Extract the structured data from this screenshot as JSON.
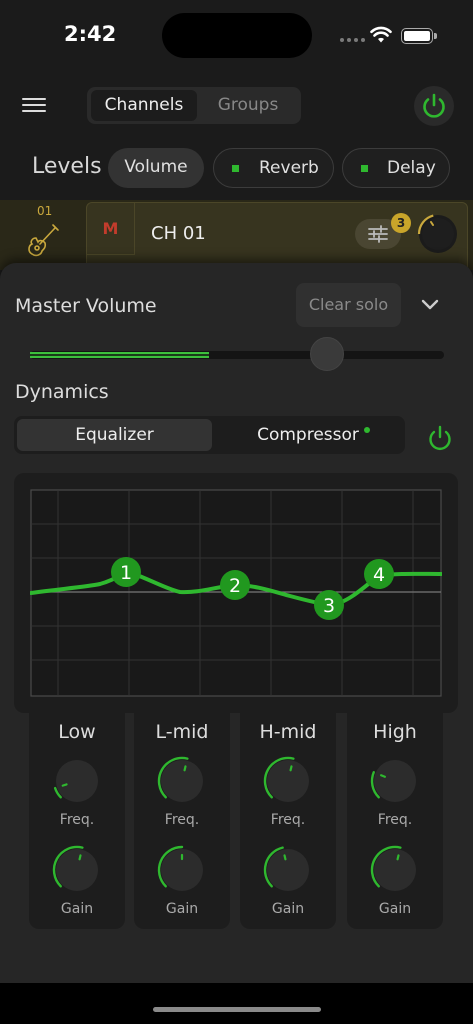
{
  "status_bar": {
    "time": "2:42"
  },
  "nav": {
    "tabs": [
      {
        "label": "Channels"
      },
      {
        "label": "Groups"
      }
    ]
  },
  "levels": {
    "label": "Levels",
    "pills": [
      {
        "label": "Volume"
      },
      {
        "label": "Reverb"
      },
      {
        "label": "Delay"
      }
    ]
  },
  "channel": {
    "number": "01",
    "mute_label": "M",
    "name": "CH 01",
    "fx_badge": "3"
  },
  "master": {
    "label": "Master Volume",
    "clear_solo_label": "Clear solo",
    "volume_level": 0.5
  },
  "dynamics": {
    "label": "Dynamics",
    "tabs": [
      {
        "label": "Equalizer"
      },
      {
        "label": "Compressor"
      }
    ]
  },
  "eq_graph": {
    "points": [
      {
        "label": "1"
      },
      {
        "label": "2"
      },
      {
        "label": "3"
      },
      {
        "label": "4"
      }
    ]
  },
  "bands": [
    {
      "name": "Low",
      "freq_label": "Freq.",
      "gain_label": "Gain",
      "freq_level": 0.1,
      "gain_level": 0.55
    },
    {
      "name": "L-mid",
      "freq_label": "Freq.",
      "gain_label": "Gain",
      "freq_level": 0.55,
      "gain_level": 0.5
    },
    {
      "name": "H-mid",
      "freq_label": "Freq.",
      "gain_label": "Gain",
      "freq_level": 0.55,
      "gain_level": 0.45
    },
    {
      "name": "High",
      "freq_label": "Freq.",
      "gain_label": "Gain",
      "freq_level": 0.25,
      "gain_level": 0.55
    }
  ],
  "colors": {
    "accent": "#2fb82f",
    "background": "#262626",
    "channel_accent": "#c9a83d",
    "mute": "#c23c2c"
  }
}
